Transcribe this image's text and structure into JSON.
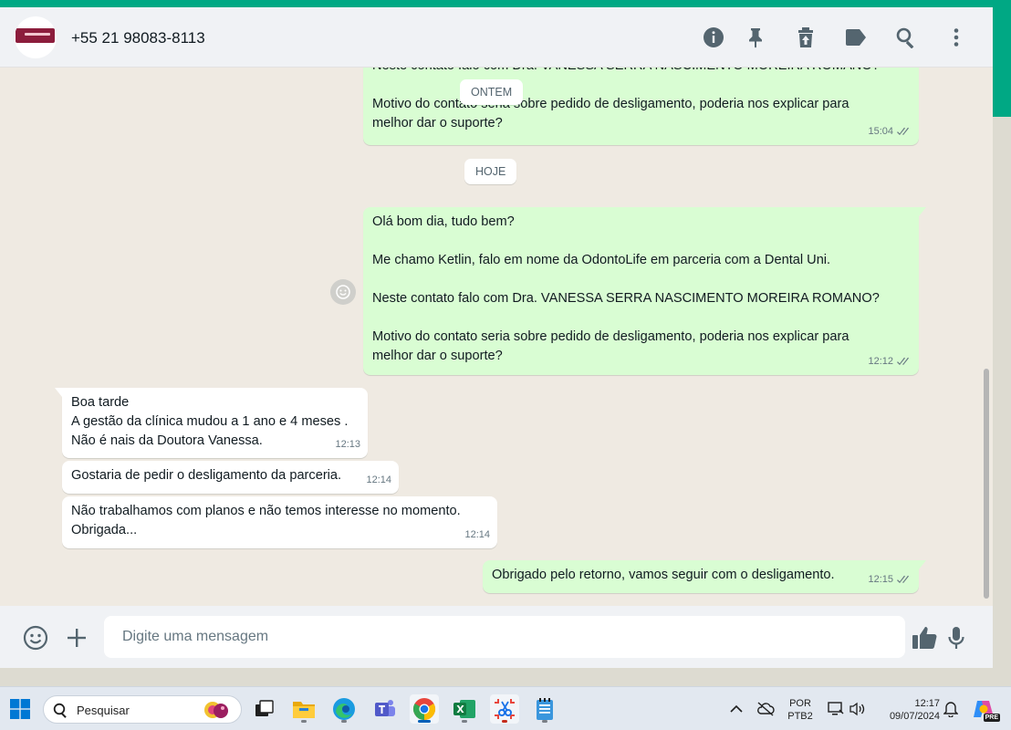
{
  "header": {
    "contact": "+55 21 98083-8113"
  },
  "day_chips": {
    "yesterday": "ONTEM",
    "today": "HOJE"
  },
  "messages": {
    "m0": {
      "line_top": "Neste contato falo com Dra. VANESSA SERRA NASCIMENTO MOREIRA ROMANO?",
      "line1": "Motivo do contato seria sobre pedido de desligamento, poderia nos explicar para",
      "line2": "melhor dar o suporte?",
      "time": "15:04"
    },
    "m1": {
      "line1": "Olá bom dia, tudo bem?",
      "line2": "Me chamo Ketlin, falo em nome da OdontoLife em parceria com a Dental Uni.",
      "line3": "Neste contato falo com Dra. VANESSA SERRA NASCIMENTO MOREIRA ROMANO?",
      "line4": "Motivo do contato seria sobre pedido de desligamento, poderia nos explicar para",
      "line5": "melhor dar o suporte?",
      "time": "12:12"
    },
    "m2": {
      "line1": "Boa tarde",
      "line2": "A gestão da clínica mudou a 1 ano e 4 meses .",
      "line3": "Não é nais da Doutora Vanessa.",
      "time": "12:13"
    },
    "m3": {
      "line1": "Gostaria de pedir o desligamento da parceria.",
      "time": "12:14"
    },
    "m4": {
      "line1": "Não trabalhamos com planos e não temos interesse no momento.",
      "line2": "Obrigada...",
      "time": "12:14"
    },
    "m5": {
      "line1": "Obrigado pelo retorno, vamos seguir com o desligamento.",
      "time": "12:15"
    }
  },
  "composer": {
    "placeholder": "Digite uma mensagem"
  },
  "taskbar": {
    "search_label": "Pesquisar",
    "lang_top": "POR",
    "lang_bottom": "PTB2",
    "clock_time": "12:17",
    "clock_date": "09/07/2024",
    "copilot_badge": "PRE"
  },
  "colors": {
    "accent": "#00a884",
    "outgoing_bubble": "#d9fdd3",
    "incoming_bubble": "#ffffff",
    "chat_background": "#efeae2"
  }
}
